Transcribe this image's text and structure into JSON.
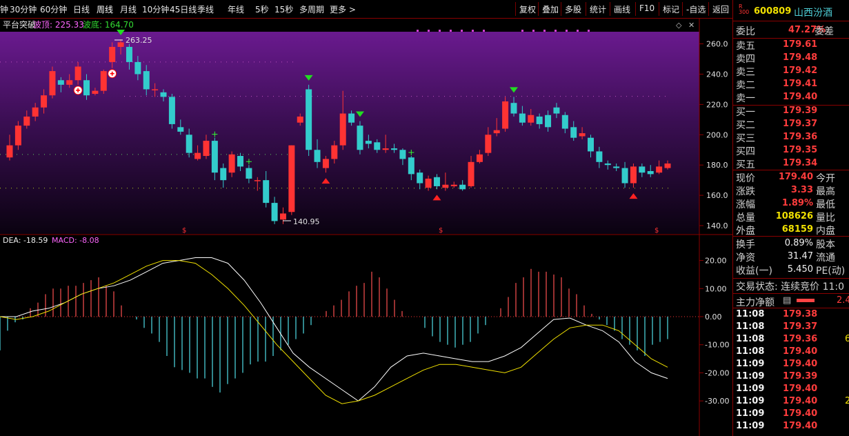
{
  "toolbar": {
    "periods": [
      "钟",
      "30分钟",
      "60分钟",
      "日线",
      "周线",
      "月线",
      "10分钟",
      "45日线",
      "季线",
      "年线",
      "5秒",
      "15秒",
      "多周期",
      "更多 >"
    ],
    "active_index": 4,
    "tools": [
      "复权",
      "叠加",
      "多股",
      "统计",
      "画线",
      "F10",
      "标记",
      "-自选",
      "返回"
    ]
  },
  "main_chart": {
    "indicator_name": "平台突破",
    "top_label": "波顶: 225.33",
    "bottom_label": "波底: 164.70",
    "high_label": "263.25",
    "low_label": "140.95"
  },
  "macd_panel": {
    "dea_label": "DEA: -18.59",
    "macd_label": "MACD: -8.08"
  },
  "colors": {
    "up": "#ff3333",
    "down": "#33cccc",
    "accent_red": "#8b0000",
    "yellow": "#f0e000"
  },
  "chart_data": {
    "type": "candlestick",
    "price_axis_ticks": [
      "260.0",
      "240.0",
      "220.0",
      "200.0",
      "180.0",
      "160.0",
      "140.0"
    ],
    "macd_axis_ticks": [
      "20.00",
      "10.00",
      "0.00",
      "-10.00",
      "-20.00",
      "-30.00"
    ],
    "ylim": [
      135,
      268
    ],
    "candles": [
      [
        185,
        193,
        183,
        200
      ],
      [
        193,
        206,
        190,
        209
      ],
      [
        206,
        212,
        204,
        216
      ],
      [
        212,
        218,
        209,
        221
      ],
      [
        218,
        226,
        214,
        230
      ],
      [
        226,
        242,
        224,
        245
      ],
      [
        236,
        233,
        228,
        238
      ],
      [
        233,
        236,
        231,
        240
      ],
      [
        236,
        245,
        233,
        248
      ],
      [
        236,
        226,
        223,
        240
      ],
      [
        227,
        229,
        226,
        231
      ],
      [
        229,
        242,
        227,
        243
      ],
      [
        248,
        258,
        244,
        261
      ],
      [
        258,
        261,
        253,
        263
      ],
      [
        258,
        248,
        243,
        260
      ],
      [
        248,
        240,
        236,
        252
      ],
      [
        242,
        230,
        226,
        246
      ],
      [
        230,
        230,
        225,
        234
      ],
      [
        228,
        225,
        222,
        230
      ],
      [
        225,
        207,
        204,
        227
      ],
      [
        205,
        202,
        200,
        210
      ],
      [
        200,
        188,
        185,
        204
      ],
      [
        184,
        188,
        183,
        193
      ],
      [
        186,
        196,
        184,
        200
      ],
      [
        196,
        175,
        170,
        198
      ],
      [
        178,
        170,
        165,
        181
      ],
      [
        175,
        187,
        172,
        189
      ],
      [
        186,
        179,
        176,
        188
      ],
      [
        178,
        171,
        168,
        180
      ],
      [
        170,
        170,
        163,
        172
      ],
      [
        170,
        155,
        152,
        176
      ],
      [
        155,
        143,
        141,
        159
      ],
      [
        144,
        148,
        141,
        152
      ],
      [
        149,
        193,
        147,
        193
      ],
      [
        208,
        212,
        206,
        214
      ],
      [
        230,
        190,
        186,
        233
      ],
      [
        190,
        182,
        178,
        197
      ],
      [
        178,
        184,
        175,
        186
      ],
      [
        184,
        193,
        181,
        196
      ],
      [
        193,
        214,
        190,
        229
      ],
      [
        214,
        208,
        206,
        216
      ],
      [
        206,
        190,
        187,
        209
      ],
      [
        196,
        194,
        191,
        200
      ],
      [
        195,
        190,
        188,
        197
      ],
      [
        190,
        191,
        188,
        200
      ],
      [
        191,
        190,
        188,
        194
      ],
      [
        190,
        184,
        180,
        191
      ],
      [
        185,
        174,
        170,
        186
      ],
      [
        175,
        168,
        164,
        177
      ],
      [
        165,
        171,
        163,
        173
      ],
      [
        172,
        166,
        164,
        174
      ],
      [
        165,
        167,
        163,
        175
      ],
      [
        166,
        167,
        165,
        169
      ],
      [
        167,
        164,
        163,
        170
      ],
      [
        166,
        182,
        165,
        186
      ],
      [
        182,
        187,
        181,
        190
      ],
      [
        188,
        200,
        186,
        205
      ],
      [
        201,
        203,
        199,
        211
      ],
      [
        204,
        222,
        202,
        225
      ],
      [
        221,
        214,
        212,
        225
      ],
      [
        214,
        208,
        206,
        219
      ],
      [
        208,
        213,
        206,
        217
      ],
      [
        212,
        207,
        204,
        214
      ],
      [
        213,
        205,
        202,
        216
      ],
      [
        218,
        214,
        211,
        221
      ],
      [
        213,
        204,
        201,
        215
      ],
      [
        205,
        198,
        196,
        209
      ],
      [
        199,
        201,
        197,
        205
      ],
      [
        198,
        189,
        185,
        200
      ],
      [
        189,
        182,
        178,
        192
      ],
      [
        181,
        180,
        177,
        183
      ],
      [
        179,
        178,
        176,
        181
      ],
      [
        178,
        168,
        165,
        182
      ],
      [
        168,
        179,
        165,
        181
      ],
      [
        179,
        175,
        172,
        181
      ],
      [
        176,
        174,
        172,
        180
      ],
      [
        175,
        179,
        174,
        183
      ],
      [
        178,
        181,
        177,
        183
      ]
    ],
    "dif": [
      0,
      0,
      2,
      3,
      5,
      8,
      10,
      11,
      13,
      16,
      19,
      20,
      21,
      21,
      19,
      13,
      5,
      -4,
      -13,
      -18,
      -22,
      -26,
      -30,
      -25,
      -18,
      -14,
      -13,
      -14,
      -15,
      -16,
      -16,
      -14,
      -11,
      -6,
      -1,
      -0.5,
      -3,
      -5,
      -9,
      -16,
      -20,
      -22
    ],
    "dea": [
      0,
      -1,
      0,
      2,
      5,
      8,
      10,
      12,
      15,
      18,
      20,
      20,
      19,
      15,
      10,
      4,
      -3,
      -10,
      -16,
      -22,
      -28,
      -31,
      -30,
      -28,
      -25,
      -22,
      -19,
      -17,
      -17,
      -18,
      -19,
      -20,
      -18,
      -13,
      -8,
      -4,
      -3,
      -3,
      -5,
      -10,
      -15,
      -18
    ],
    "hist": [
      -12,
      -5,
      -2,
      -1,
      3,
      5,
      8,
      10,
      10,
      11,
      11,
      12,
      13,
      14,
      11,
      9,
      4,
      0,
      -1,
      -4,
      -6,
      -9,
      -14,
      -18,
      -19,
      -20,
      -22,
      -22,
      -25,
      -27,
      -24,
      -22,
      -20,
      -17,
      -16,
      -16,
      -14,
      -12,
      -10,
      -8,
      -6,
      -3,
      0,
      2,
      4,
      6,
      9,
      11,
      12,
      16,
      14,
      10,
      6,
      2,
      0,
      0,
      -4,
      -7,
      -9,
      -10,
      -11,
      -10,
      -9,
      -6,
      -3,
      0,
      3,
      7,
      12,
      14,
      17,
      16,
      16,
      15,
      14,
      10,
      8,
      4,
      1,
      -1,
      -3,
      -5,
      -8,
      -10,
      -12,
      -14,
      -10,
      -9,
      -8
    ]
  },
  "quote": {
    "code": "600809",
    "name": "山西汾酒",
    "badge_top": "R",
    "badge_bottom": "300",
    "weibi_label": "委比",
    "weibi_value": "47.27%",
    "weicha_label": "委差",
    "asks": [
      {
        "label": "卖五",
        "price": "179.61"
      },
      {
        "label": "卖四",
        "price": "179.48"
      },
      {
        "label": "卖三",
        "price": "179.42"
      },
      {
        "label": "卖二",
        "price": "179.41"
      },
      {
        "label": "卖一",
        "price": "179.40"
      }
    ],
    "bids": [
      {
        "label": "买一",
        "price": "179.39"
      },
      {
        "label": "买二",
        "price": "179.37"
      },
      {
        "label": "买三",
        "price": "179.36"
      },
      {
        "label": "买四",
        "price": "179.35"
      },
      {
        "label": "买五",
        "price": "179.34"
      }
    ],
    "stats": [
      {
        "label": "现价",
        "value": "179.40",
        "label2": "今开"
      },
      {
        "label": "涨跌",
        "value": "3.33",
        "label2": "最高"
      },
      {
        "label": "涨幅",
        "value": "1.89%",
        "label2": "最低"
      },
      {
        "label": "总量",
        "value": "108626",
        "label2": "量比"
      },
      {
        "label": "外盘",
        "value": "68159",
        "label2": "内盘"
      }
    ],
    "fundamentals": [
      {
        "label": "换手",
        "value": "0.89%",
        "label2": "股本"
      },
      {
        "label": "净资",
        "value": "31.47",
        "label2": "流通"
      },
      {
        "label": "收益(一)",
        "value": "5.450",
        "label2": "PE(动)"
      }
    ],
    "trade_status": "交易状态: 连续竞价 11:0",
    "main_force_label": "主力净额",
    "main_force_value": "2.4",
    "ticks": [
      {
        "time": "11:08",
        "price": "179.38",
        "vol": ""
      },
      {
        "time": "11:08",
        "price": "179.37",
        "vol": ""
      },
      {
        "time": "11:08",
        "price": "179.36",
        "vol": "6"
      },
      {
        "time": "11:08",
        "price": "179.40",
        "vol": ""
      },
      {
        "time": "11:09",
        "price": "179.40",
        "vol": ""
      },
      {
        "time": "11:09",
        "price": "179.39",
        "vol": ""
      },
      {
        "time": "11:09",
        "price": "179.40",
        "vol": ""
      },
      {
        "time": "11:09",
        "price": "179.40",
        "vol": "2"
      },
      {
        "time": "11:09",
        "price": "179.40",
        "vol": ""
      },
      {
        "time": "11:09",
        "price": "179.40",
        "vol": ""
      }
    ]
  }
}
